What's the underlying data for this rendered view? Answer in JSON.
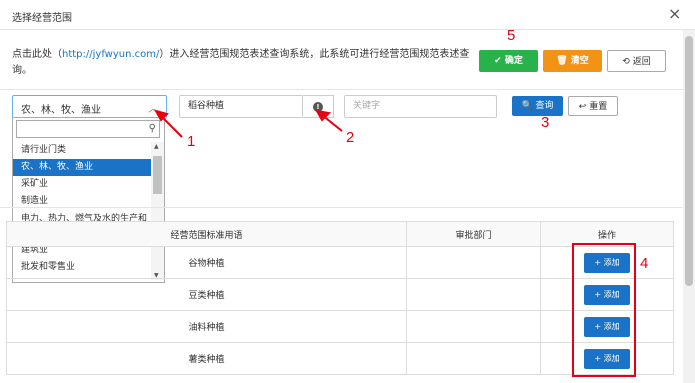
{
  "dialog": {
    "title": "选择经营范围",
    "close": "×"
  },
  "intro": {
    "prefix": "点击此处（",
    "link": "http://jyfwyun.com/",
    "suffix": "）进入经营范围规范表述查询系统，此系统可进行经营范围规范表述查询。"
  },
  "buttons": {
    "confirm": "✔ 确定",
    "clear": "🗑 清空",
    "back": "⟲ 返回",
    "query": "🔍 查询",
    "reset": "↩ 重置"
  },
  "industry_select": {
    "selected": "农、林、牧、渔业",
    "options": [
      "请行业门类",
      "农、林、牧、渔业",
      "采矿业",
      "制造业",
      "电力、热力、燃气及水的生产和供应业",
      "建筑业",
      "批发和零售业"
    ],
    "selected_index": 1
  },
  "keyword_input": {
    "value": "稻谷种植"
  },
  "keyword2_input": {
    "placeholder": "关键字"
  },
  "table": {
    "headers": [
      "经营范围标准用语",
      "审批部门",
      "操作"
    ],
    "rows": [
      {
        "term": "谷物种植",
        "dept": "",
        "action": "+ 添加"
      },
      {
        "term": "豆类种植",
        "dept": "",
        "action": "+ 添加"
      },
      {
        "term": "油料种植",
        "dept": "",
        "action": "+ 添加"
      },
      {
        "term": "薯类种植",
        "dept": "",
        "action": "+ 添加"
      }
    ]
  },
  "annotations": {
    "n1": "1",
    "n2": "2",
    "n3": "3",
    "n4": "4",
    "n5": "5"
  },
  "colors": {
    "primary": "#1a73c7",
    "success": "#2ab24a",
    "warning": "#f29315",
    "annotation": "#e60012"
  }
}
